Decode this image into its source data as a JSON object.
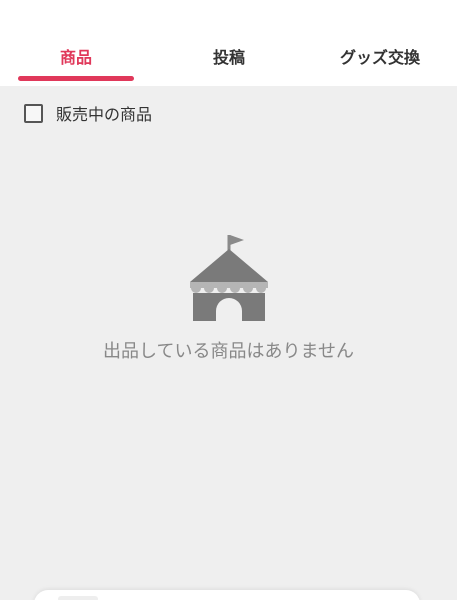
{
  "tabs": {
    "products": "商品",
    "posts": "投稿",
    "goods_exchange": "グッズ交換",
    "active_color": "#e0385a"
  },
  "filter": {
    "label": "販売中の商品",
    "checked": false
  },
  "empty_state": {
    "icon": "tent-icon",
    "message": "出品している商品はありません"
  }
}
